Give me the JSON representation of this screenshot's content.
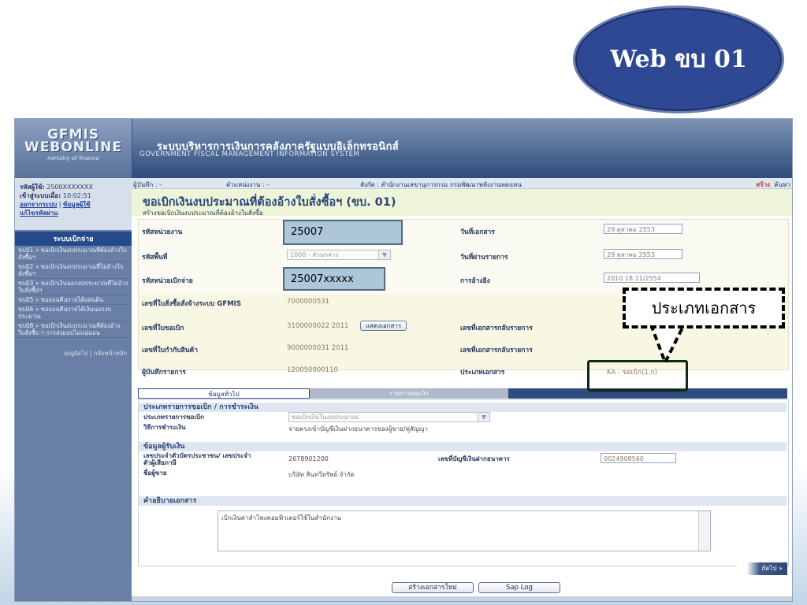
{
  "slide": {
    "title_oval": "Web ขบ 01"
  },
  "banner": {
    "logo_text": "GFMIS WEBONLINE",
    "logo_sub": "ministry of finance",
    "title_th": "ระบบบริหารการเงินการคลังภาครัฐแบบอิเล็กทรอนิกส์",
    "title_en": "GOVERNMENT FISCAL MANAGEMENT INFORMATION SYSTEM"
  },
  "sidebar": {
    "user_label": "รหัสผู้ใช้:",
    "user_value": "2500XXXXXXX",
    "login_label": "เข้าสู่ระบบเมื่อ:",
    "login_time": "10:02:51",
    "logout_link": "ออกจากระบบ",
    "user_info_link": "ข้อมูลผู้ใช้",
    "change_pw_link": "แก้ไขรหัสผ่าน",
    "menu_title": "ระบบเบิกจ่าย",
    "items": [
      "ขบ01 » ขอเบิกเงินงบประมาณที่ต้องอ้างใบสั่งซื้อฯ",
      "ขบ02 » ขอเบิกเงินงบประมาณที่ไม่อ้างใบสั่งซื้อฯ",
      "ขบ03 » ขอเบิกเงินนอกงบประมาณที่ไม่อ้างใบสั่งซื้อฯ",
      "ขบ05 » ขอถอนคืนรายได้แผ่นดิน",
      "ขบ06 » ขอถอนคืนรายได้เงินนอกงบประมาณ",
      "ขบ08 » ขอเบิกเงินงบประมาณที่ต้องอ้างใบสั่งซื้อ ฯ การส่งมอบไม่แน่นอน"
    ],
    "footer_links": "เมนูถัดไป | กลับหน้าหลัก"
  },
  "infobar": {
    "doc_label": "ผู้บันทึก : -",
    "position_label": "ตำแหน่งงาน : -",
    "org_label": "สังกัด : สำนักงานเลขานุการกรม กรมพัฒนาพลังงานทดแทน",
    "create_link": "สร้าง",
    "search_link": "ค้นหา"
  },
  "page": {
    "title": "ขอเบิกเงินงบประมาณที่ต้องอ้างใบสั่งซื้อฯ (ขบ. 01)",
    "subtitle": "สร้างขอเบิกเงินงบประมาณที่ต้องอ้างใบสั่งซื้อ"
  },
  "form": {
    "unit_code_label": "รหัสหน่วยงาน",
    "unit_code_value": "25007",
    "area_code_label": "รหัสพื้นที่",
    "area_code_value": "1000 - ส่วนกลาง",
    "disb_unit_label": "รหัสหน่วยเบิกจ่าย",
    "disb_unit_value": "25007xxxxx",
    "po_label": "เลขที่ใบสั่งซื้อสั่งจ้างระบบ GFMIS",
    "po_value": "7000000531",
    "req_no_label": "เลขที่ใบขอเบิก",
    "req_no_value": "3100000022 2011",
    "show_doc_button": "แสดงเอกสาร",
    "invoice_label": "เลขที่ใบกำกับสินค้า",
    "invoice_value": "9000000031 2011",
    "recorder_label": "ผู้บันทึกรายการ",
    "recorder_value": "120050000110",
    "doc_date_label": "วันที่เอกสาร",
    "doc_date_value": "29 ตุลาคม 2553",
    "post_date_label": "วันที่ผ่านรายการ",
    "post_date_value": "29 ตุลาคม 2553",
    "ref_label": "การอ้างอิง",
    "ref_value": "2010.18.11/2554",
    "rev_doc_label_1": "เลขที่เอกสารกลับรายการ",
    "rev_doc_label_2": "เลขที่เอกสารกลับรายการ",
    "doc_type_label": "ประเภทเอกสาร",
    "doc_type_value": "KA - ขอเบิก(1.ก)"
  },
  "tabs": [
    "ข้อมูลทั่วไป",
    "รายการขอเบิก"
  ],
  "detail": {
    "section_payment": "ประเภทรายการขอเบิก / การชำระเงิน",
    "req_type_label": "ประเภทรายการขอเบิก",
    "req_type_value": "ขอเบิกเงินในงบประมาณ",
    "pay_method_label": "วิธีการชำระเงิน",
    "pay_method_value": "จ่ายตรงเข้าบัญชีเงินฝากธนาคารของผู้ขาย/คู่สัญญา",
    "section_payee": "ข้อมูลผู้รับเงิน",
    "tax_id_label": "เลขประจำตัวบัตรประชาชน/ เลขประจำตัวผู้เสียภาษี",
    "tax_id_value": "2678901200",
    "bank_acct_label": "เลขที่บัญชีเงินฝากธนาคาร",
    "bank_acct_value": "0024908560",
    "vendor_label": "ชื่อผู้ขาย",
    "vendor_value": "บริษัท สินทวีทรัพย์ จำกัด",
    "section_desc": "คำอธิบายเอกสาร",
    "desc_value": "เบิกเงินค่าสำโพงคอมพิวเตอร์ใช้ในสำนักงาน"
  },
  "buttons": {
    "next": "ถัดไป »",
    "new_doc": "สร้างเอกสารใหม่",
    "sap_log": "Sap Log"
  },
  "callout": {
    "label": "ประเภทเอกสาร"
  }
}
